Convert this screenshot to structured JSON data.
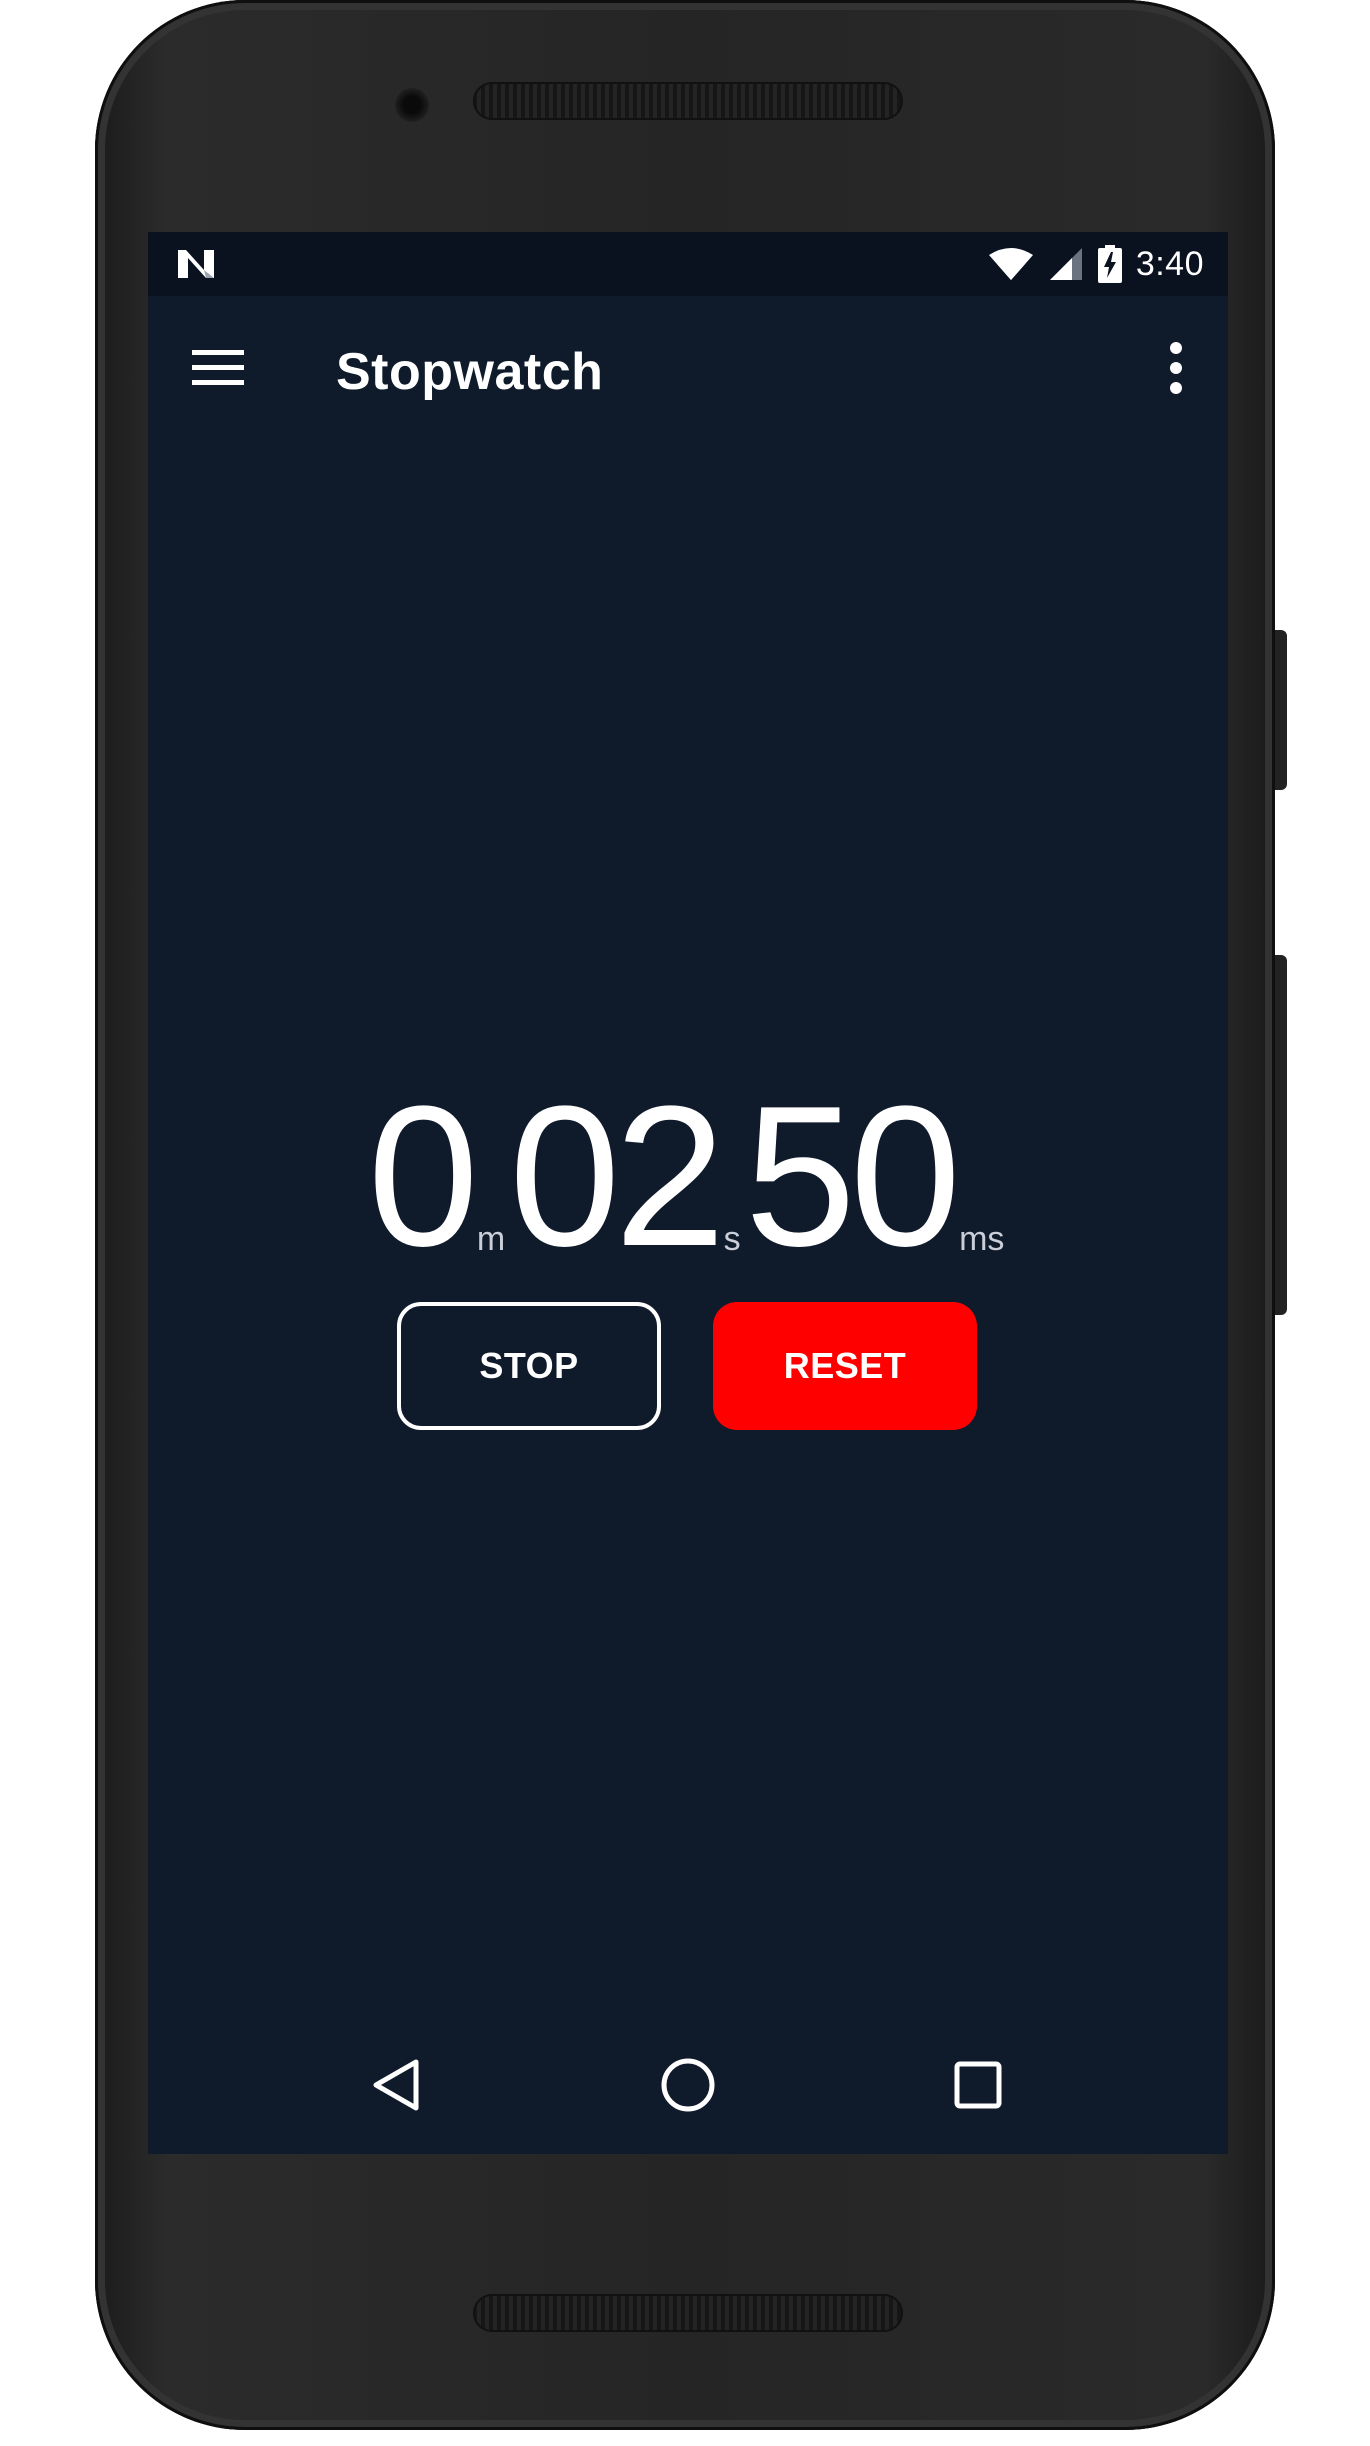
{
  "status_bar": {
    "notification_icon": "android-n-icon",
    "wifi_icon": "wifi-icon",
    "signal_icon": "cell-signal-icon",
    "battery_icon": "battery-charging-icon",
    "time": "3:40"
  },
  "app_bar": {
    "menu_icon": "hamburger-menu-icon",
    "title": "Stopwatch",
    "overflow_icon": "more-vert-icon"
  },
  "timer": {
    "minutes": "0",
    "minutes_unit": "m",
    "seconds": "02",
    "seconds_unit": "s",
    "milliseconds": "50",
    "milliseconds_unit": "ms"
  },
  "controls": {
    "stop_label": "STOP",
    "reset_label": "RESET"
  },
  "nav_bar": {
    "back_icon": "back-triangle-icon",
    "home_icon": "home-circle-icon",
    "recents_icon": "recents-square-icon"
  },
  "colors": {
    "screen_background": "#0f1a2b",
    "reset_button": "#ff0000",
    "text": "#ffffff"
  }
}
